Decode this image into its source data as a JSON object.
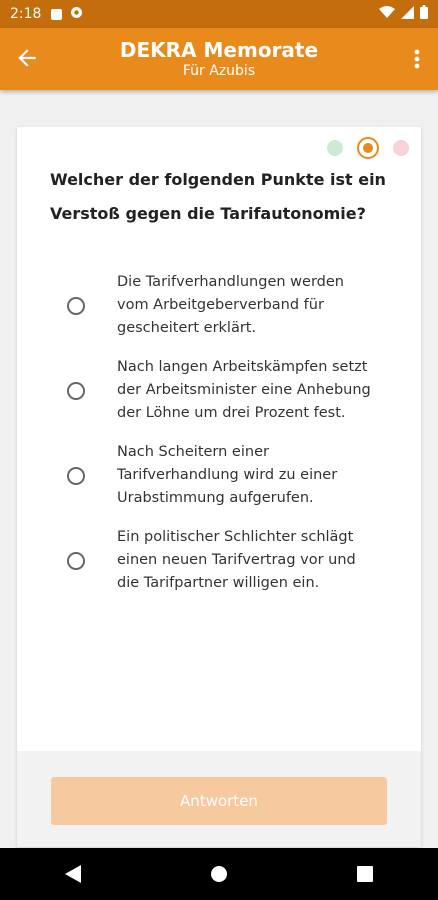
{
  "status_bar": {
    "time": "2:18"
  },
  "app_bar": {
    "title": "DEKRA Memorate",
    "subtitle": "Für Azubis"
  },
  "progress": {
    "states": [
      "answered",
      "current",
      "pending"
    ]
  },
  "question": {
    "text": "Welcher der folgenden Punkte ist ein Verstoß gegen die Tarifautonomie?",
    "answers": [
      "Die Tarifverhandlungen werden vom Arbeitgeberverband für gescheitert erklärt.",
      "Nach langen Arbeitskämpfen setzt der Arbeitsminister eine Anhebung der Löhne um drei Prozent fest.",
      "Nach Scheitern einer Tarifverhandlung wird zu einer Urabstimmung aufgerufen.",
      "Ein politischer Schlichter schlägt einen neuen Tarifvertrag vor und die Tarifpartner willigen ein."
    ]
  },
  "submit_label": "Antworten",
  "colors": {
    "accent": "#e98a1d",
    "status_bar": "#c46d0c",
    "button_disabled": "#f6c99e",
    "dot_answered": "#cdebd2",
    "dot_pending": "#f7d2d6"
  },
  "icons": {
    "back": "arrow-left-icon",
    "more": "more-vert-icon",
    "nav_back": "triangle-back-icon",
    "nav_home": "circle-home-icon",
    "nav_recent": "square-recents-icon"
  }
}
